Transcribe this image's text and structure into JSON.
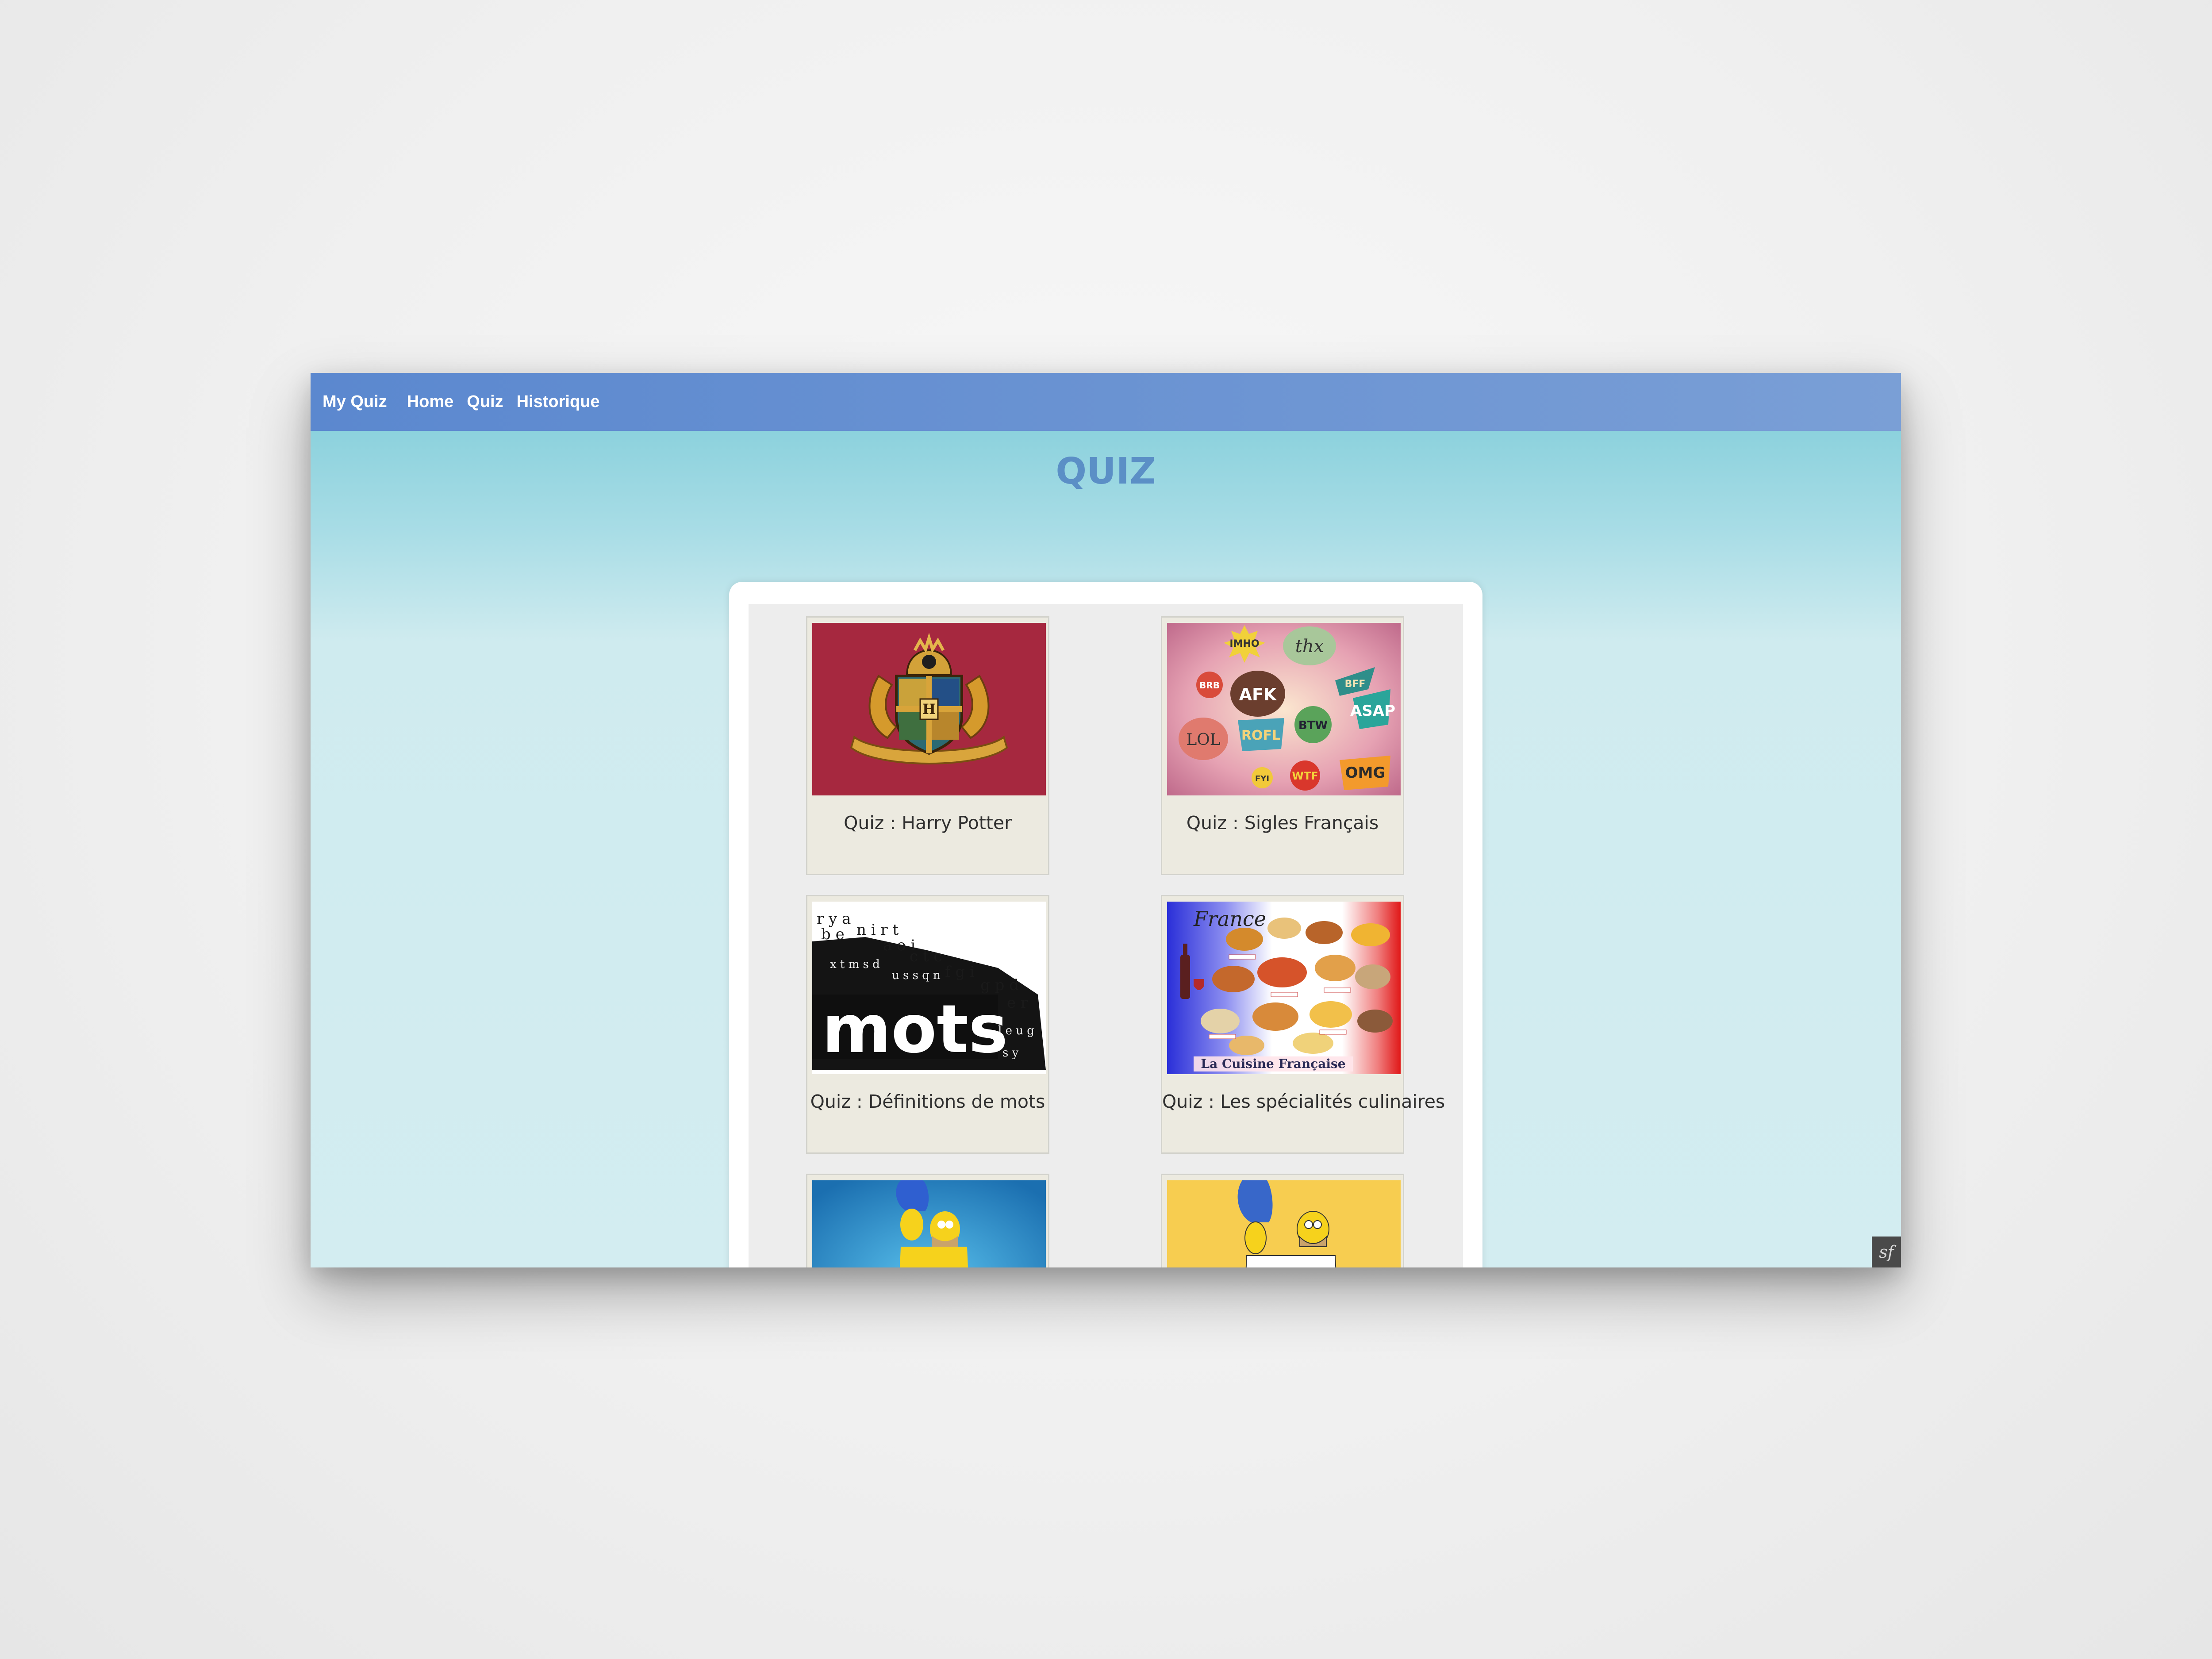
{
  "navbar": {
    "brand": "My Quiz",
    "links": [
      "Home",
      "Quiz",
      "Historique"
    ]
  },
  "page": {
    "title": "QUIZ"
  },
  "quizzes": [
    {
      "caption": "Quiz : Harry Potter",
      "image": "hogwarts-crest-image"
    },
    {
      "caption": "Quiz : Sigles Français",
      "image": "acronym-speech-bubbles-image",
      "bubbles": [
        "thx",
        "IMHO",
        "BRB",
        "AFK",
        "BFF",
        "ASAP",
        "LOL",
        "ROFL",
        "BTW",
        "FYI",
        "WTF",
        "OMG"
      ]
    },
    {
      "caption": "Quiz : Définitions de mots",
      "image": "mots-letters-image",
      "word": "mots"
    },
    {
      "caption": "Quiz : Les spécialités culinaires",
      "image": "french-cuisine-poster-image",
      "poster_title": "France",
      "poster_footer": "La Cuisine Française"
    },
    {
      "caption": "",
      "image": "simpsons-blue-image"
    },
    {
      "caption": "",
      "image": "simpsons-yellow-image"
    }
  ],
  "debug_toolbar": {
    "label": "sf",
    "icon": "symfony-icon"
  },
  "colors": {
    "navbar": "#5b88cf",
    "title": "#5b8fc6",
    "card_bg": "#eceae0",
    "crimson": "#a52a45"
  }
}
